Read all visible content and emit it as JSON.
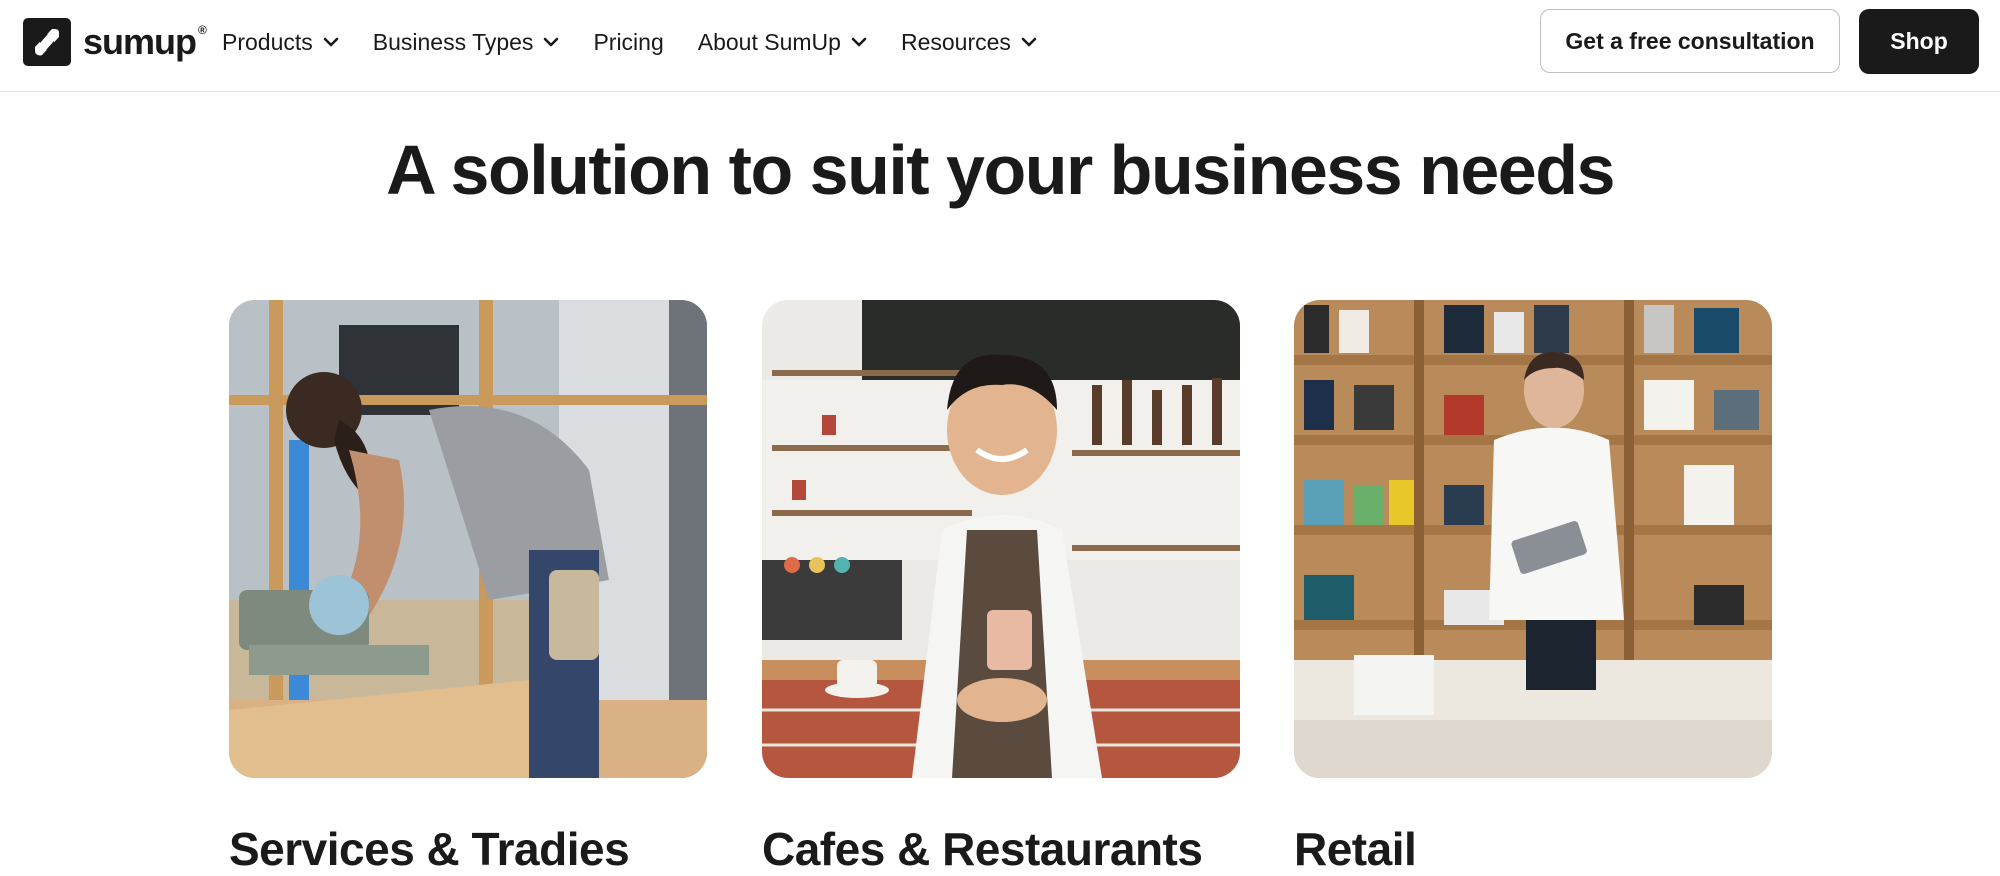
{
  "nav": {
    "logo_text": "sumup",
    "logo_reg": "®",
    "items": [
      {
        "label": "Products",
        "has_dropdown": true
      },
      {
        "label": "Business Types",
        "has_dropdown": true
      },
      {
        "label": "Pricing",
        "has_dropdown": false
      },
      {
        "label": "About SumUp",
        "has_dropdown": true
      },
      {
        "label": "Resources",
        "has_dropdown": true
      }
    ],
    "consult_label": "Get a free consultation",
    "shop_label": "Shop"
  },
  "main": {
    "heading": "A solution to suit your business needs",
    "cards": [
      {
        "title": "Services & Tradies",
        "image_alt": "Tradesperson cutting timber with a mitre saw"
      },
      {
        "title": "Cafes & Restaurants",
        "image_alt": "Smiling barista in an apron at a cafe counter"
      },
      {
        "title": "Retail",
        "image_alt": "Shop assistant with a tablet in a bookstore"
      }
    ]
  },
  "colors": {
    "text": "#1a1a1a",
    "shop_button_bg": "#1a1a1a",
    "border": "#e3e3e3"
  },
  "icons": {
    "logo": "sumup-logo-icon",
    "dropdown": "chevron-down-icon"
  }
}
